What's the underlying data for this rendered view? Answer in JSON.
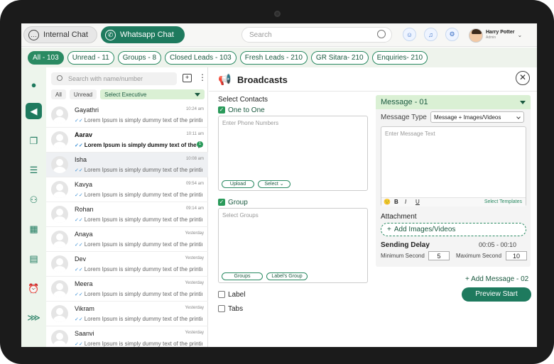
{
  "header": {
    "internal_chat": "Internal Chat",
    "whatsapp_chat": "Whatsapp Chat",
    "search_placeholder": "Search",
    "user_name": "Harry Potter",
    "user_role": "Admin"
  },
  "filters": [
    {
      "label": "All - 103",
      "active": true
    },
    {
      "label": "Unread - 11",
      "active": false
    },
    {
      "label": "Groups - 8",
      "active": false
    },
    {
      "label": "Closed Leads - 103",
      "active": false
    },
    {
      "label": "Fresh Leads - 210",
      "active": false
    },
    {
      "label": "GR Sitara- 210",
      "active": false
    },
    {
      "label": "Enquiries- 210",
      "active": false
    }
  ],
  "chat_list": {
    "search_placeholder": "Search with name/number",
    "tab_all": "All",
    "tab_unread": "Unread",
    "tab_select": "Select Executive",
    "items": [
      {
        "name": "Gayathri",
        "time": "10:24 am",
        "msg": "Lorem Ipsum is simply dummy text of the printin...",
        "unread": false
      },
      {
        "name": "Aarav",
        "time": "10:11 am",
        "msg": "Lorem Ipsum is simply dummy text of the printin...",
        "unread": true,
        "badge": "1"
      },
      {
        "name": "Isha",
        "time": "10:08 am",
        "msg": "Lorem Ipsum is simply dummy text of the printin...",
        "unread": false
      },
      {
        "name": "Kavya",
        "time": "09:54 am",
        "msg": "Lorem Ipsum is simply dummy text of the printin...",
        "unread": false
      },
      {
        "name": "Rohan",
        "time": "09:14 am",
        "msg": "Lorem Ipsum is simply dummy text of the printin...",
        "unread": false
      },
      {
        "name": "Anaya",
        "time": "Yesterday",
        "msg": "Lorem Ipsum is simply dummy text of the printin...",
        "unread": false
      },
      {
        "name": "Dev",
        "time": "Yesterday",
        "msg": "Lorem Ipsum is simply dummy text of the printin...",
        "unread": false
      },
      {
        "name": "Meera",
        "time": "Yesterday",
        "msg": "Lorem Ipsum is simply dummy text of the printin...",
        "unread": false
      },
      {
        "name": "Vikram",
        "time": "Yesterday",
        "msg": "Lorem Ipsum is simply dummy text of the printin...",
        "unread": false
      },
      {
        "name": "Saanvi",
        "time": "Yesterday",
        "msg": "Lorem Ipsum is simply dummy text of the printin...",
        "unread": false
      }
    ]
  },
  "broadcast": {
    "title": "Broadcasts",
    "select_contacts": "Select Contacts",
    "one_to_one": "One to One",
    "phone_placeholder": "Enter Phone Numbers",
    "upload": "Upload",
    "select": "Select",
    "group": "Group",
    "groups_placeholder": "Select Groups",
    "groups_btn": "Groups",
    "labels_group_btn": "Label's Group",
    "label": "Label",
    "tabs": "Tabs",
    "message_title": "Message - 01",
    "message_type_label": "Message Type",
    "message_type_value": "Message + Images/Videos",
    "message_placeholder": "Enter Message Text",
    "select_templates": "Select Templates",
    "attachment": "Attachment",
    "add_images": "Add Images/Videos",
    "sending_delay": "Sending Delay",
    "delay_range": "00:05 - 00:10",
    "min_label": "Minimum Second",
    "min_value": "5",
    "max_label": "Maximum Second",
    "max_value": "10",
    "add_message": "Add Message - 02",
    "preview_start": "Preview Start"
  }
}
